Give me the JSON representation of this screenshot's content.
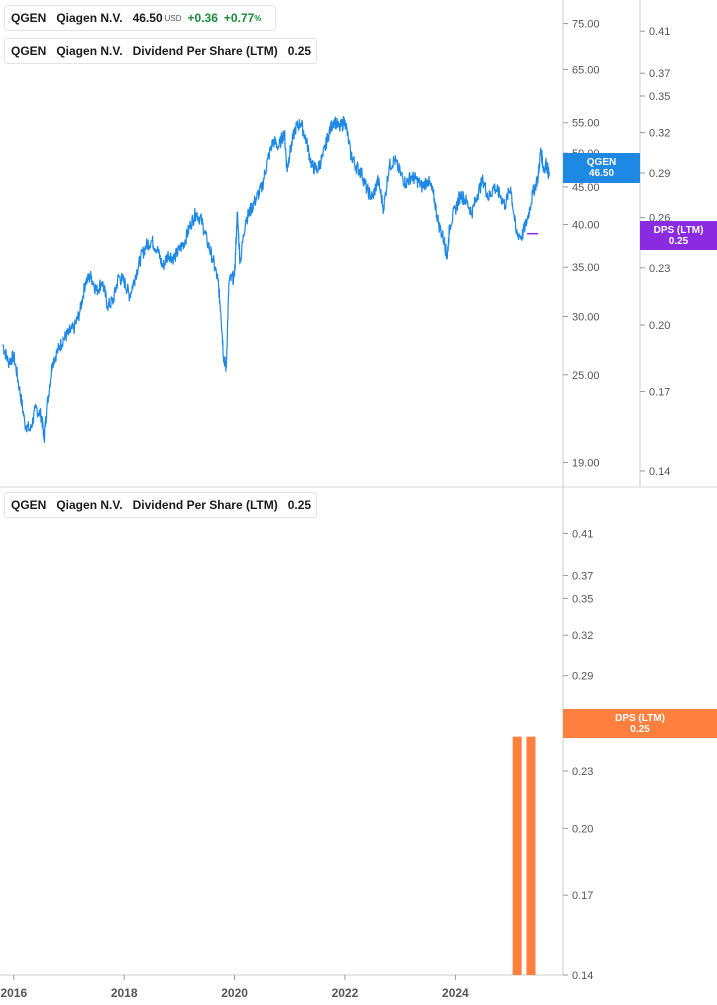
{
  "legend_price": {
    "ticker": "QGEN",
    "name": "Qiagen N.V.",
    "price": "46.50",
    "currency": "USD",
    "change": "+0.36",
    "change_pct": "+0.77",
    "pct_sign": "%",
    "color": "#1e88e5"
  },
  "legend_dps_top": {
    "ticker": "QGEN",
    "name": "Qiagen N.V.",
    "metric": "Dividend Per Share (LTM)",
    "value": "0.25",
    "color": "#8a2be2"
  },
  "legend_dps_bottom": {
    "ticker": "QGEN",
    "name": "Qiagen N.V.",
    "metric": "Dividend Per Share (LTM)",
    "value": "0.25",
    "color": "#ff7f3f"
  },
  "price_tag": {
    "line1": "QGEN",
    "line2": "46.50"
  },
  "dps_tag_top": {
    "line1": "DPS (LTM)",
    "line2": "0.25"
  },
  "dps_tag_bottom": {
    "line1": "DPS (LTM)",
    "line2": "0.25"
  },
  "chart_data": [
    {
      "type": "line",
      "series": [
        {
          "name": "QGEN",
          "color": "#1e88e5",
          "points": [
            [
              2015.8,
              27.5
            ],
            [
              2015.9,
              26.0
            ],
            [
              2016.0,
              26.5
            ],
            [
              2016.1,
              24.0
            ],
            [
              2016.2,
              21.5
            ],
            [
              2016.3,
              21.0
            ],
            [
              2016.4,
              22.5
            ],
            [
              2016.5,
              22.0
            ],
            [
              2016.55,
              20.5
            ],
            [
              2016.6,
              22.5
            ],
            [
              2016.7,
              26.0
            ],
            [
              2016.8,
              27.0
            ],
            [
              2016.9,
              28.0
            ],
            [
              2017.0,
              28.5
            ],
            [
              2017.1,
              29.0
            ],
            [
              2017.2,
              30.5
            ],
            [
              2017.3,
              33.5
            ],
            [
              2017.4,
              34.0
            ],
            [
              2017.5,
              32.5
            ],
            [
              2017.6,
              33.5
            ],
            [
              2017.7,
              31.0
            ],
            [
              2017.8,
              31.5
            ],
            [
              2017.9,
              34.0
            ],
            [
              2018.0,
              33.5
            ],
            [
              2018.1,
              32.0
            ],
            [
              2018.2,
              34.0
            ],
            [
              2018.3,
              36.0
            ],
            [
              2018.4,
              37.5
            ],
            [
              2018.5,
              38.0
            ],
            [
              2018.6,
              37.0
            ],
            [
              2018.7,
              35.0
            ],
            [
              2018.8,
              36.5
            ],
            [
              2018.9,
              36.0
            ],
            [
              2019.0,
              37.0
            ],
            [
              2019.1,
              38.0
            ],
            [
              2019.2,
              40.0
            ],
            [
              2019.3,
              41.5
            ],
            [
              2019.4,
              40.5
            ],
            [
              2019.5,
              38.0
            ],
            [
              2019.6,
              36.0
            ],
            [
              2019.7,
              33.5
            ],
            [
              2019.75,
              30.5
            ],
            [
              2019.8,
              26.5
            ],
            [
              2019.85,
              25.5
            ],
            [
              2019.9,
              33.5
            ],
            [
              2020.0,
              34.0
            ],
            [
              2020.05,
              41.5
            ],
            [
              2020.1,
              35.5
            ],
            [
              2020.2,
              40.5
            ],
            [
              2020.3,
              42.0
            ],
            [
              2020.4,
              43.5
            ],
            [
              2020.5,
              45.0
            ],
            [
              2020.6,
              49.0
            ],
            [
              2020.7,
              52.0
            ],
            [
              2020.8,
              51.0
            ],
            [
              2020.9,
              53.5
            ],
            [
              2020.95,
              47.5
            ],
            [
              2021.0,
              50.0
            ],
            [
              2021.1,
              54.0
            ],
            [
              2021.2,
              55.0
            ],
            [
              2021.3,
              52.0
            ],
            [
              2021.4,
              48.0
            ],
            [
              2021.5,
              47.5
            ],
            [
              2021.6,
              49.5
            ],
            [
              2021.7,
              53.0
            ],
            [
              2021.8,
              55.5
            ],
            [
              2021.9,
              54.0
            ],
            [
              2022.0,
              55.5
            ],
            [
              2022.1,
              50.0
            ],
            [
              2022.2,
              48.0
            ],
            [
              2022.3,
              47.0
            ],
            [
              2022.4,
              44.5
            ],
            [
              2022.5,
              43.5
            ],
            [
              2022.6,
              46.0
            ],
            [
              2022.7,
              42.0
            ],
            [
              2022.8,
              48.0
            ],
            [
              2022.9,
              49.0
            ],
            [
              2023.0,
              47.0
            ],
            [
              2023.1,
              45.5
            ],
            [
              2023.2,
              46.5
            ],
            [
              2023.3,
              46.0
            ],
            [
              2023.4,
              45.0
            ],
            [
              2023.5,
              46.0
            ],
            [
              2023.6,
              44.0
            ],
            [
              2023.7,
              40.0
            ],
            [
              2023.8,
              38.0
            ],
            [
              2023.85,
              36.0
            ],
            [
              2023.9,
              40.0
            ],
            [
              2024.0,
              42.0
            ],
            [
              2024.1,
              44.0
            ],
            [
              2024.2,
              43.0
            ],
            [
              2024.3,
              41.5
            ],
            [
              2024.4,
              44.0
            ],
            [
              2024.5,
              46.0
            ],
            [
              2024.6,
              43.5
            ],
            [
              2024.7,
              45.0
            ],
            [
              2024.8,
              44.0
            ],
            [
              2024.9,
              42.5
            ],
            [
              2025.0,
              45.0
            ],
            [
              2025.1,
              39.0
            ],
            [
              2025.2,
              38.5
            ],
            [
              2025.3,
              40.5
            ],
            [
              2025.4,
              44.0
            ],
            [
              2025.5,
              46.5
            ],
            [
              2025.55,
              50.5
            ],
            [
              2025.6,
              47.5
            ],
            [
              2025.65,
              48.5
            ],
            [
              2025.7,
              46.5
            ]
          ]
        },
        {
          "name": "DPS (LTM)",
          "color": "#8a2be2",
          "axis": "right",
          "points": [
            [
              2025.3,
              0.25
            ],
            [
              2025.5,
              0.25
            ]
          ]
        }
      ],
      "xlim": [
        2015.75,
        2025.95
      ],
      "ylim": [
        18.5,
        79
      ],
      "scale": "log",
      "yticks": [
        "75.00",
        "65.00",
        "55.00",
        "50.00",
        "45.00",
        "40.00",
        "35.00",
        "30.00",
        "25.00",
        "19.00"
      ],
      "y2ticks": [
        "0.41",
        "0.37",
        "0.35",
        "0.32",
        "0.29",
        "0.26",
        "0.23",
        "0.20",
        "0.17",
        "0.14"
      ],
      "y2lim": [
        0.14,
        0.435
      ],
      "grid": false
    },
    {
      "type": "bar",
      "series": [
        {
          "name": "DPS (LTM)",
          "color": "#ff7f3f",
          "bars": [
            {
              "x": 2025.12,
              "value": 0.25
            },
            {
              "x": 2025.37,
              "value": 0.25
            }
          ]
        }
      ],
      "xlim": [
        2015.75,
        2025.95
      ],
      "ylim": [
        0.14,
        0.435
      ],
      "scale": "log",
      "yticks": [
        "0.41",
        "0.37",
        "0.35",
        "0.32",
        "0.29",
        "0.26",
        "0.23",
        "0.20",
        "0.17",
        "0.14"
      ],
      "xticks": [
        "2016",
        "2018",
        "2020",
        "2022",
        "2024"
      ],
      "grid": false
    }
  ]
}
